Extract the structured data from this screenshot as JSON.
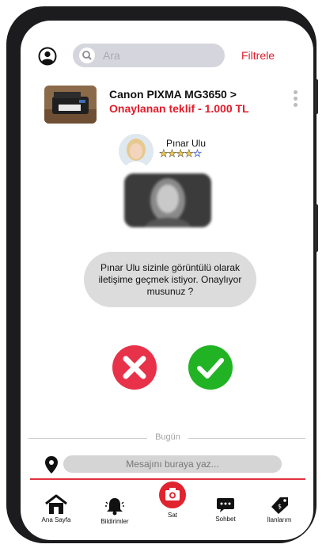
{
  "search": {
    "placeholder": "Ara"
  },
  "header": {
    "filter_label": "Filtrele"
  },
  "product": {
    "title": "Canon PIXMA MG3650 >",
    "offer": "Onaylanan teklif - 1.000 TL"
  },
  "user": {
    "name": "Pınar Ulu",
    "rating": 4,
    "max_rating": 5
  },
  "message": {
    "text": "Pınar Ulu sizinle görüntülü olarak iletişime geçmek istiyor. Onaylıyor musunuz ?"
  },
  "chat": {
    "date_label": "Bugün",
    "input_placeholder": "Mesajını buraya yaz..."
  },
  "nav": {
    "home": "Ana Sayfa",
    "notifications": "Bildirimler",
    "sell": "Sat",
    "chat": "Sohbet",
    "listings": "İlanlarım"
  },
  "colors": {
    "accent": "#e21b2a",
    "reject": "#e8324a",
    "accept": "#22b324"
  }
}
